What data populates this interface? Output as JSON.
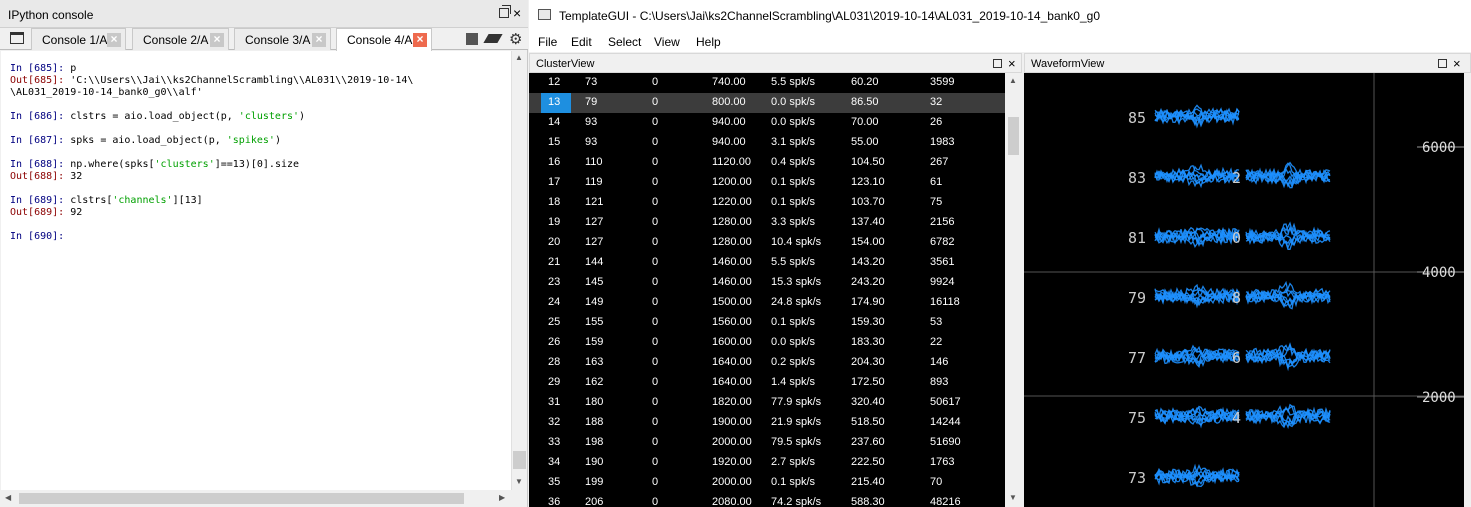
{
  "ipython": {
    "title": "IPython console",
    "tabs": [
      {
        "label": "Console 1/A"
      },
      {
        "label": "Console 2/A"
      },
      {
        "label": "Console 3/A"
      },
      {
        "label": "Console 4/A"
      }
    ],
    "active_tab": 3,
    "lines": [
      {
        "parts": [
          {
            "cls": "in",
            "text": "In [685]: "
          },
          {
            "cls": "",
            "text": "p"
          }
        ]
      },
      {
        "parts": [
          {
            "cls": "out",
            "text": "Out[685]: "
          },
          {
            "cls": "",
            "text": "'C:\\\\Users\\\\Jai\\\\ks2ChannelScrambling\\\\AL031\\\\2019-10-14\\"
          }
        ]
      },
      {
        "parts": [
          {
            "cls": "",
            "text": "\\AL031_2019-10-14_bank0_g0\\\\alf'"
          }
        ]
      },
      {
        "parts": []
      },
      {
        "parts": [
          {
            "cls": "in",
            "text": "In [686]: "
          },
          {
            "cls": "",
            "text": "clstrs = aio.load_object(p, "
          },
          {
            "cls": "str",
            "text": "'clusters'"
          },
          {
            "cls": "",
            "text": ")"
          }
        ]
      },
      {
        "parts": []
      },
      {
        "parts": [
          {
            "cls": "in",
            "text": "In [687]: "
          },
          {
            "cls": "",
            "text": "spks = aio.load_object(p, "
          },
          {
            "cls": "str",
            "text": "'spikes'"
          },
          {
            "cls": "",
            "text": ")"
          }
        ]
      },
      {
        "parts": []
      },
      {
        "parts": [
          {
            "cls": "in",
            "text": "In [688]: "
          },
          {
            "cls": "",
            "text": "np.where(spks["
          },
          {
            "cls": "str",
            "text": "'clusters'"
          },
          {
            "cls": "",
            "text": "]==13)[0].size"
          }
        ]
      },
      {
        "parts": [
          {
            "cls": "out",
            "text": "Out[688]: "
          },
          {
            "cls": "",
            "text": "32"
          }
        ]
      },
      {
        "parts": []
      },
      {
        "parts": [
          {
            "cls": "in",
            "text": "In [689]: "
          },
          {
            "cls": "",
            "text": "clstrs["
          },
          {
            "cls": "str",
            "text": "'channels'"
          },
          {
            "cls": "",
            "text": "][13]"
          }
        ]
      },
      {
        "parts": [
          {
            "cls": "out",
            "text": "Out[689]: "
          },
          {
            "cls": "",
            "text": "92"
          }
        ]
      },
      {
        "parts": []
      },
      {
        "parts": [
          {
            "cls": "in",
            "text": "In [690]: "
          }
        ]
      }
    ]
  },
  "tgui": {
    "title": "TemplateGUI - C:\\Users\\Jai\\ks2ChannelScrambling\\AL031\\2019-10-14\\AL031_2019-10-14_bank0_g0",
    "menu": [
      "File",
      "Edit",
      "Select",
      "View",
      "Help"
    ],
    "cluster_view_title": "ClusterView",
    "waveform_view_title": "WaveformView",
    "selected_row": 1,
    "rows": [
      [
        "12",
        "73",
        "0",
        "740.00",
        "5.5 spk/s",
        "60.20",
        "3599"
      ],
      [
        "13",
        "79",
        "0",
        "800.00",
        "0.0 spk/s",
        "86.50",
        "32"
      ],
      [
        "14",
        "93",
        "0",
        "940.00",
        "0.0 spk/s",
        "70.00",
        "26"
      ],
      [
        "15",
        "93",
        "0",
        "940.00",
        "3.1 spk/s",
        "55.00",
        "1983"
      ],
      [
        "16",
        "110",
        "0",
        "1120.00",
        "0.4 spk/s",
        "104.50",
        "267"
      ],
      [
        "17",
        "119",
        "0",
        "1200.00",
        "0.1 spk/s",
        "123.10",
        "61"
      ],
      [
        "18",
        "121",
        "0",
        "1220.00",
        "0.1 spk/s",
        "103.70",
        "75"
      ],
      [
        "19",
        "127",
        "0",
        "1280.00",
        "3.3 spk/s",
        "137.40",
        "2156"
      ],
      [
        "20",
        "127",
        "0",
        "1280.00",
        "10.4 spk/s",
        "154.00",
        "6782"
      ],
      [
        "21",
        "144",
        "0",
        "1460.00",
        "5.5 spk/s",
        "143.20",
        "3561"
      ],
      [
        "23",
        "145",
        "0",
        "1460.00",
        "15.3 spk/s",
        "243.20",
        "9924"
      ],
      [
        "24",
        "149",
        "0",
        "1500.00",
        "24.8 spk/s",
        "174.90",
        "16118"
      ],
      [
        "25",
        "155",
        "0",
        "1560.00",
        "0.1 spk/s",
        "159.30",
        "53"
      ],
      [
        "26",
        "159",
        "0",
        "1600.00",
        "0.0 spk/s",
        "183.30",
        "22"
      ],
      [
        "28",
        "163",
        "0",
        "1640.00",
        "0.2 spk/s",
        "204.30",
        "146"
      ],
      [
        "29",
        "162",
        "0",
        "1640.00",
        "1.4 spk/s",
        "172.50",
        "893"
      ],
      [
        "31",
        "180",
        "0",
        "1820.00",
        "77.9 spk/s",
        "320.40",
        "50617"
      ],
      [
        "32",
        "188",
        "0",
        "1900.00",
        "21.9 spk/s",
        "518.50",
        "14244"
      ],
      [
        "33",
        "198",
        "0",
        "2000.00",
        "79.5 spk/s",
        "237.60",
        "51690"
      ],
      [
        "34",
        "190",
        "0",
        "1920.00",
        "2.7 spk/s",
        "222.50",
        "1763"
      ],
      [
        "35",
        "199",
        "0",
        "2000.00",
        "0.1 spk/s",
        "215.40",
        "70"
      ],
      [
        "36",
        "206",
        "0",
        "2080.00",
        "74.2 spk/s",
        "588.30",
        "48216"
      ]
    ],
    "waveform": {
      "channel_labels": [
        "85",
        "83",
        "81",
        "79",
        "77",
        "75",
        "73"
      ],
      "partial_labels": [
        "2",
        "0",
        "8",
        "6",
        "4"
      ],
      "axis_ticks": [
        "6000",
        "4000",
        "2000"
      ],
      "waveform_color": "#1e90ff"
    }
  }
}
